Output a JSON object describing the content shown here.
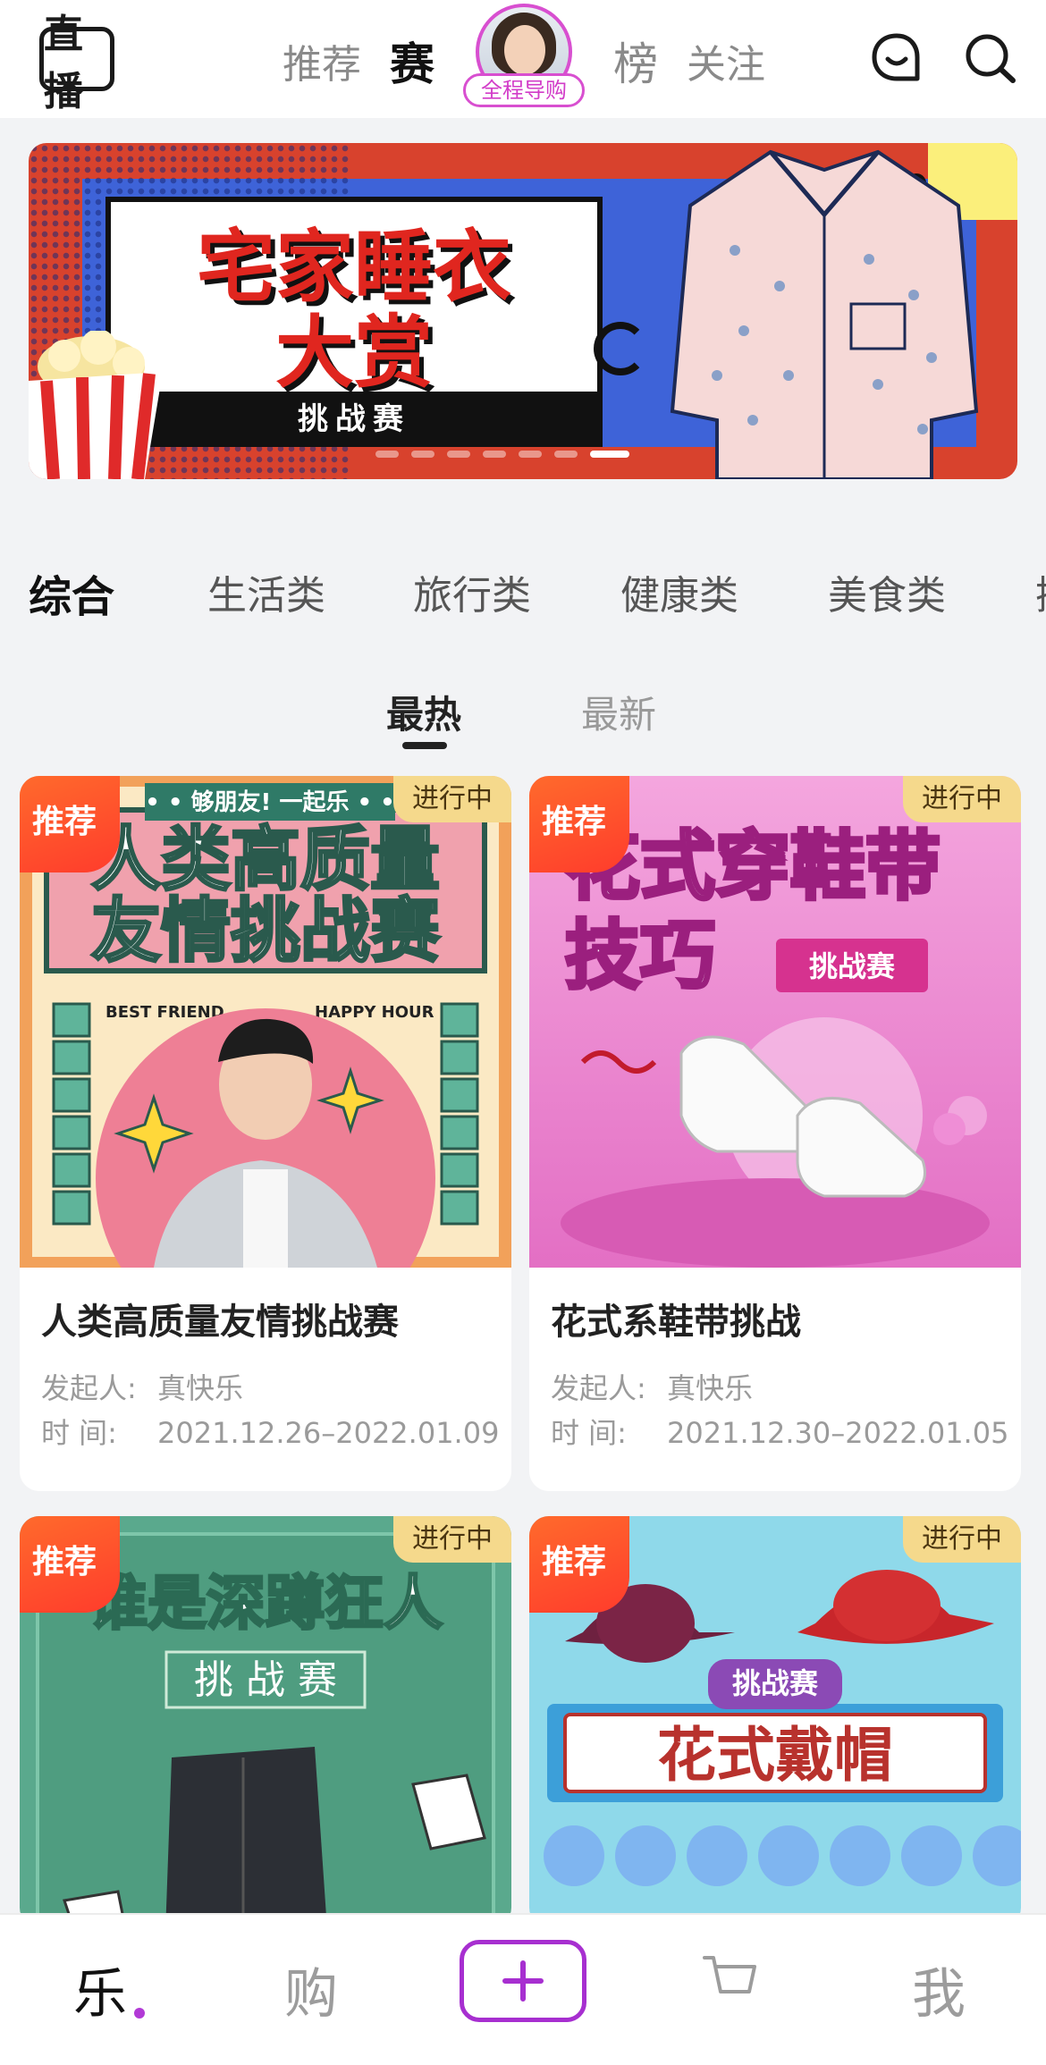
{
  "header": {
    "logo_text": "直播",
    "tabs": [
      {
        "label": "推荐",
        "active": false
      },
      {
        "label": "赛",
        "active": true
      },
      {
        "label": "榜",
        "active": false
      },
      {
        "label": "关注",
        "active": false
      }
    ],
    "guide_tag": "全程导购",
    "icons": [
      "message-icon",
      "search-icon"
    ]
  },
  "banner": {
    "title_line1": "宅家睡衣",
    "title_line2": "大赏",
    "subtitle": "挑战赛",
    "slide_count": 7,
    "active_slide": 7
  },
  "categories": [
    {
      "label": "综合",
      "active": true
    },
    {
      "label": "生活类",
      "active": false
    },
    {
      "label": "旅行类",
      "active": false
    },
    {
      "label": "健康类",
      "active": false
    },
    {
      "label": "美食类",
      "active": false
    },
    {
      "label": "操",
      "active": false
    }
  ],
  "sort_tabs": [
    {
      "label": "最热",
      "active": true
    },
    {
      "label": "最新",
      "active": false
    }
  ],
  "cards": [
    {
      "badge": "推荐",
      "status": "进行中",
      "image_theme": "人类高质量友情挑战赛",
      "title": "人类高质量友情挑战赛",
      "initiator_label": "发起人:",
      "initiator": "真快乐",
      "time_label": "时 间:",
      "time": "2021.12.26–2022.01.09"
    },
    {
      "badge": "推荐",
      "status": "进行中",
      "image_theme": "花式穿鞋带技巧",
      "title": "花式系鞋带挑战",
      "initiator_label": "发起人:",
      "initiator": "真快乐",
      "time_label": "时 间:",
      "time": "2021.12.30–2022.01.05"
    },
    {
      "badge": "推荐",
      "status": "进行中",
      "image_theme": "谁是深蹲狂人"
    },
    {
      "badge": "推荐",
      "status": "进行中",
      "image_theme": "花式戴帽"
    }
  ],
  "card_art": {
    "c1_top": "• • 够朋友! 一起乐 • •",
    "c1_line1": "人类高质量",
    "c1_line2": "友情挑战赛",
    "c1_tag_left": "BEST FRIEND",
    "c1_tag_right": "HAPPY HOUR",
    "c2_line1": "花式穿鞋带",
    "c2_line2": "技巧",
    "c2_pill": "挑战赛",
    "c3_line1": "谁是深蹲狂人",
    "c3_line2": "挑 战 赛",
    "c4_ribbon": "挑战赛",
    "c4_title": "花式戴帽"
  },
  "bottom_nav": [
    {
      "label": "乐",
      "active": true
    },
    {
      "label": "购",
      "active": false
    },
    {
      "label": "+",
      "active": false
    },
    {
      "label": "cart",
      "active": false
    },
    {
      "label": "我",
      "active": false
    }
  ],
  "colors": {
    "accent": "#a72fd0",
    "badge": "#ff4a2c",
    "status_badge": "#f5d98c"
  }
}
